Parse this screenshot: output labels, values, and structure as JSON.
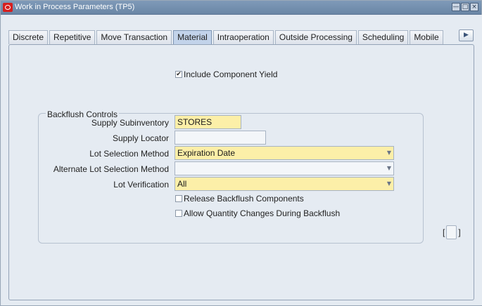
{
  "window": {
    "title": "Work in Process Parameters (TP5)",
    "controls": [
      "minimize-icon",
      "maximize-icon",
      "close-icon"
    ]
  },
  "tabs": [
    {
      "label": "Discrete",
      "active": false
    },
    {
      "label": "Repetitive",
      "active": false
    },
    {
      "label": "Move Transaction",
      "active": false
    },
    {
      "label": "Material",
      "active": true
    },
    {
      "label": "Intraoperation",
      "active": false
    },
    {
      "label": "Outside Processing",
      "active": false
    },
    {
      "label": "Scheduling",
      "active": false
    },
    {
      "label": "Mobile",
      "active": false
    }
  ],
  "options": {
    "include_component_yield": {
      "label": "Include Component Yield",
      "checked": true
    }
  },
  "backflush": {
    "title": "Backflush Controls",
    "supply_subinventory": {
      "label": "Supply Subinventory",
      "value": "STORES"
    },
    "supply_locator": {
      "label": "Supply Locator",
      "value": ""
    },
    "lot_selection_method": {
      "label": "Lot Selection Method",
      "value": "Expiration Date"
    },
    "alternate_lot_selection_method": {
      "label": "Alternate Lot Selection Method",
      "value": ""
    },
    "lot_verification": {
      "label": "Lot Verification",
      "value": "All"
    },
    "release_backflush_components": {
      "label": "Release Backflush Components",
      "checked": false
    },
    "allow_quantity_changes": {
      "label": "Allow Quantity Changes During Backflush",
      "checked": false
    }
  },
  "descriptive_flexfield": {
    "open": "[",
    "close": "]"
  },
  "colors": {
    "title_bar": "#7a95b4",
    "required_field": "#fcefa8",
    "active_tab": "#c2d3ea",
    "background": "#e5ebf2"
  }
}
